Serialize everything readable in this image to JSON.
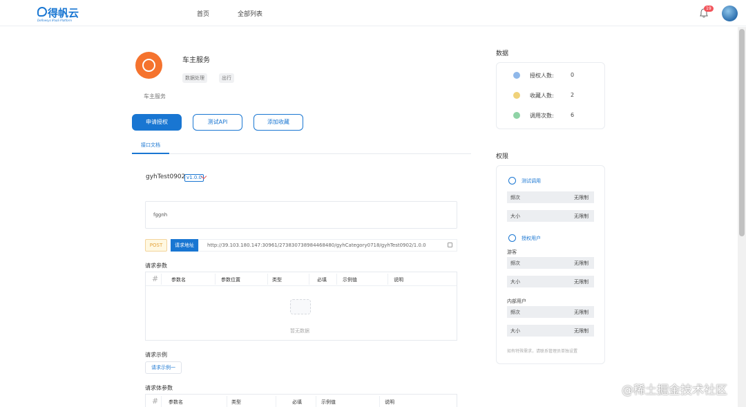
{
  "header": {
    "logo_text": "得帆云",
    "logo_sub": "Definesys iPaaS Platform",
    "nav": [
      "首页",
      "全部列表"
    ],
    "notification_count": "19"
  },
  "service": {
    "title": "车主服务",
    "tags": [
      "数据处理",
      "出行"
    ],
    "description": "车主服务",
    "buttons": {
      "apply": "申请授权",
      "test": "测试API",
      "favorite": "添加收藏"
    },
    "tab": "接口文档"
  },
  "api": {
    "name": "gyhTest0902",
    "version": "v1.0.0",
    "description": "fggnh",
    "method": "POST",
    "address_label": "请求地址",
    "address": "http://39.103.180.147:30961/27383073898446848​0/gyhCategory0718/gyhTest0902/1.0.0"
  },
  "request_params": {
    "title": "请求参数",
    "columns": [
      "#",
      "参数名",
      "参数位置",
      "类型",
      "必填",
      "示例值",
      "说明"
    ],
    "empty_text": "暂无数据"
  },
  "request_example": {
    "title": "请求示例",
    "button": "请求示例一"
  },
  "request_body": {
    "title": "请求体参数",
    "columns": [
      "#",
      "参数名",
      "类型",
      "必填",
      "示例值",
      "说明"
    ]
  },
  "stats": {
    "title": "数据",
    "items": [
      {
        "label": "授权人数:",
        "value": "0",
        "color": "#8fb8ea"
      },
      {
        "label": "收藏人数:",
        "value": "2",
        "color": "#f0d27a"
      },
      {
        "label": "调用次数:",
        "value": "6",
        "color": "#8fd3a6"
      }
    ]
  },
  "permissions": {
    "title": "权限",
    "test_call": "测试调用",
    "auth_user": "授权用户",
    "guest": "游客",
    "internal": "内部用户",
    "rows": {
      "freq": "频次",
      "size": "大小",
      "unlimited": "无限制"
    },
    "note": "如有特殊需求，请联系管理员单独设置"
  },
  "watermark": "@稀土掘金技术社区"
}
